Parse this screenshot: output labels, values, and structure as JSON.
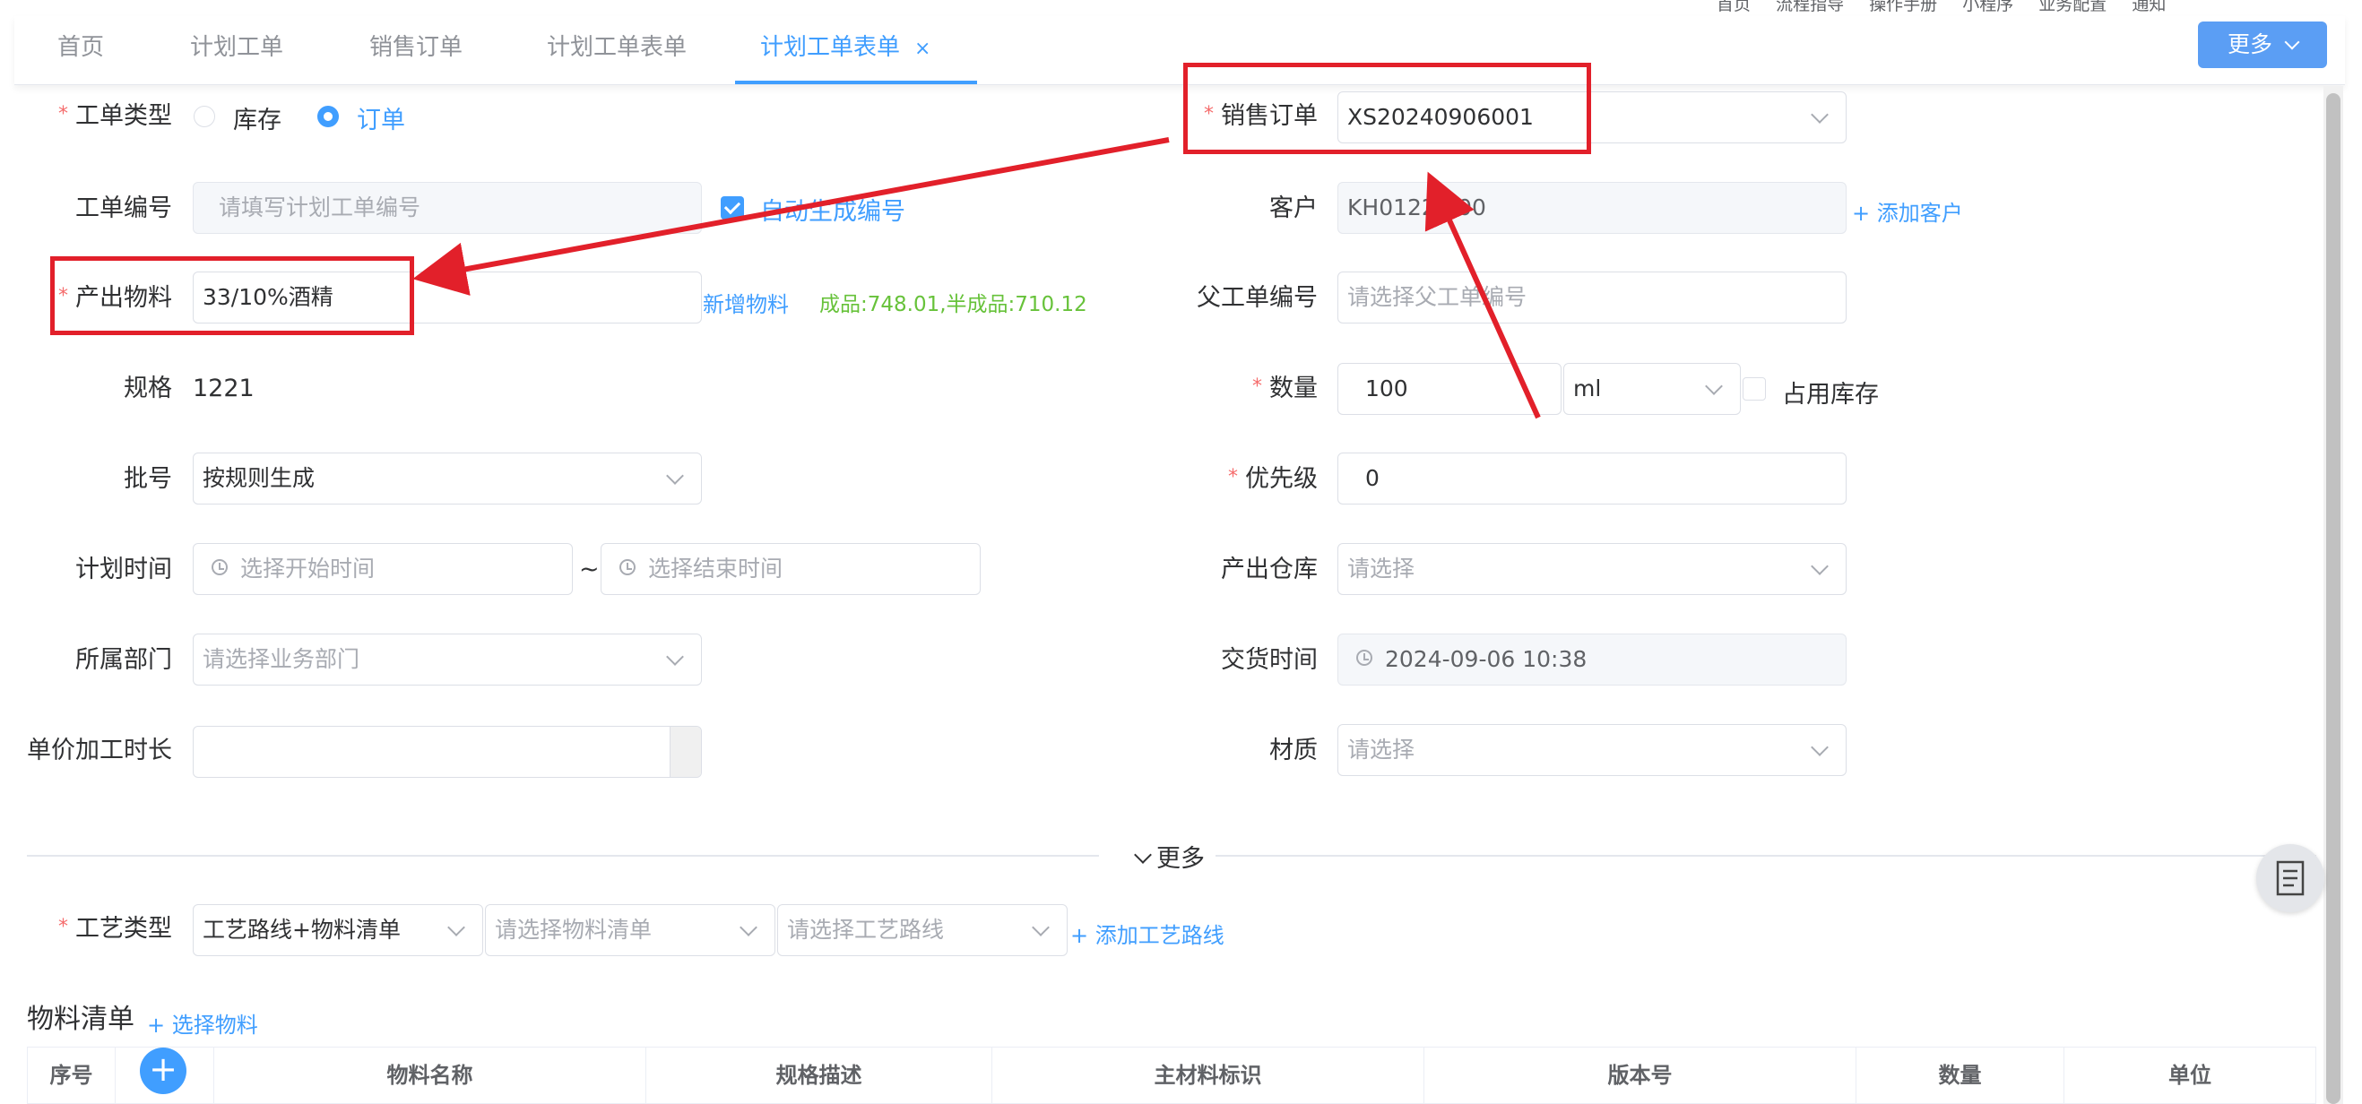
{
  "top_links": [
    "首页",
    "流程指导",
    "操作手册",
    "小程序",
    "业务配置",
    "通知"
  ],
  "tabs": [
    {
      "label": "首页"
    },
    {
      "label": "计划工单"
    },
    {
      "label": "销售订单"
    },
    {
      "label": "计划工单表单"
    },
    {
      "label": "计划工单表单",
      "close": "×"
    }
  ],
  "more_button": "更多",
  "form": {
    "order_type": {
      "label": "工单类型",
      "options": [
        "库存",
        "订单"
      ],
      "selected": "订单"
    },
    "sales_order": {
      "label": "销售订单",
      "value": "XS20240906001"
    },
    "order_no": {
      "label": "工单编号",
      "placeholder": "请填写计划工单编号",
      "auto_label": "自动生成编号"
    },
    "customer": {
      "label": "客户",
      "value": "KH0122/000",
      "add_label": "+ 添加客户"
    },
    "output_material": {
      "label": "产出物料",
      "value": "33/10%酒精",
      "add_label": "新增物料",
      "stock_info": "成品:748.01,半成品:710.12"
    },
    "parent_order": {
      "label": "父工单编号",
      "placeholder": "请选择父工单编号"
    },
    "spec": {
      "label": "规格",
      "value": "1221"
    },
    "quantity": {
      "label": "数量",
      "value": "100",
      "unit": "ml",
      "occupy_label": "占用库存"
    },
    "batch": {
      "label": "批号",
      "value": "按规则生成"
    },
    "priority": {
      "label": "优先级",
      "value": "0"
    },
    "plan_time": {
      "label": "计划时间",
      "start_placeholder": "选择开始时间",
      "separator": "~",
      "end_placeholder": "选择结束时间"
    },
    "warehouse": {
      "label": "产出仓库",
      "placeholder": "请选择"
    },
    "department": {
      "label": "所属部门",
      "placeholder": "请选择业务部门"
    },
    "delivery_time": {
      "label": "交货时间",
      "value": "2024-09-06 10:38"
    },
    "unit_time": {
      "label": "单价加工时长",
      "value": ""
    },
    "material_quality": {
      "label": "材质",
      "placeholder": "请选择"
    }
  },
  "more_section": "更多",
  "process": {
    "label": "工艺类型",
    "type_value": "工艺路线+物料清单",
    "bom_placeholder": "请选择物料清单",
    "route_placeholder": "请选择工艺路线",
    "add_route": "添加工艺路线"
  },
  "bom": {
    "title": "物料清单",
    "select_label": "选择物料",
    "columns": [
      "序号",
      "",
      "物料名称",
      "规格描述",
      "主材料标识",
      "版本号",
      "数量",
      "单位"
    ]
  },
  "annotation_color": "#e2202a",
  "accent_color": "#409eff"
}
